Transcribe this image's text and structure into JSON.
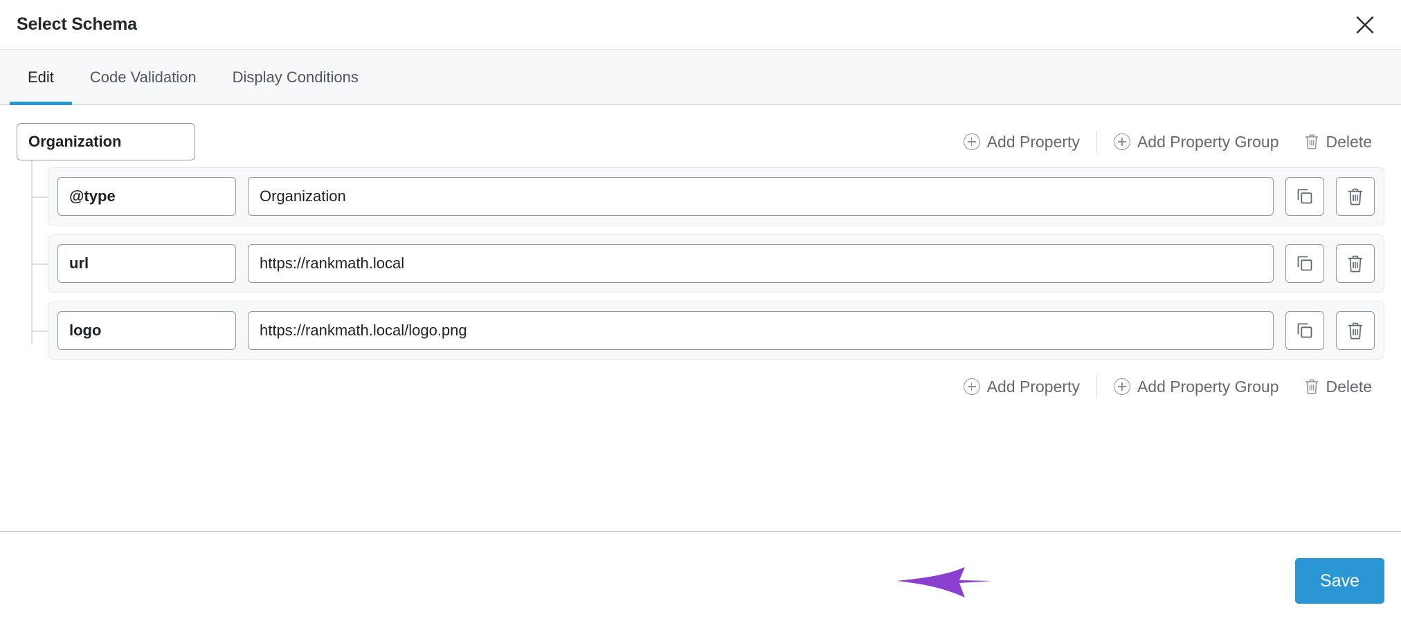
{
  "header": {
    "title": "Select Schema",
    "close_icon": "close-icon"
  },
  "tabs": [
    {
      "label": "Edit",
      "active": true
    },
    {
      "label": "Code Validation",
      "active": false
    },
    {
      "label": "Display Conditions",
      "active": false
    }
  ],
  "schema": {
    "group_name": "Organization",
    "top_actions": {
      "add_property": "Add Property",
      "add_property_group": "Add Property Group",
      "delete": "Delete"
    },
    "bottom_actions": {
      "add_property": "Add Property",
      "add_property_group": "Add Property Group",
      "delete": "Delete"
    },
    "properties": [
      {
        "key": "@type",
        "value": "Organization",
        "copy_icon": "copy-icon",
        "delete_icon": "trash-icon"
      },
      {
        "key": "url",
        "value": "https://rankmath.local",
        "copy_icon": "copy-icon",
        "delete_icon": "trash-icon"
      },
      {
        "key": "logo",
        "value": "https://rankmath.local/logo.png",
        "copy_icon": "copy-icon",
        "delete_icon": "trash-icon"
      }
    ]
  },
  "footer": {
    "save_label": "Save"
  },
  "annotation": {
    "arrow_color": "#8b3fcf",
    "points_to": "save-button"
  },
  "colors": {
    "accent": "#2a96d3",
    "tab_underline": "#2a96d3",
    "panel_bg": "#f7f8f9",
    "border": "#8f98a1",
    "text": "#1d2327",
    "muted_text": "#646970",
    "annotation_purple": "#8b3fcf"
  }
}
